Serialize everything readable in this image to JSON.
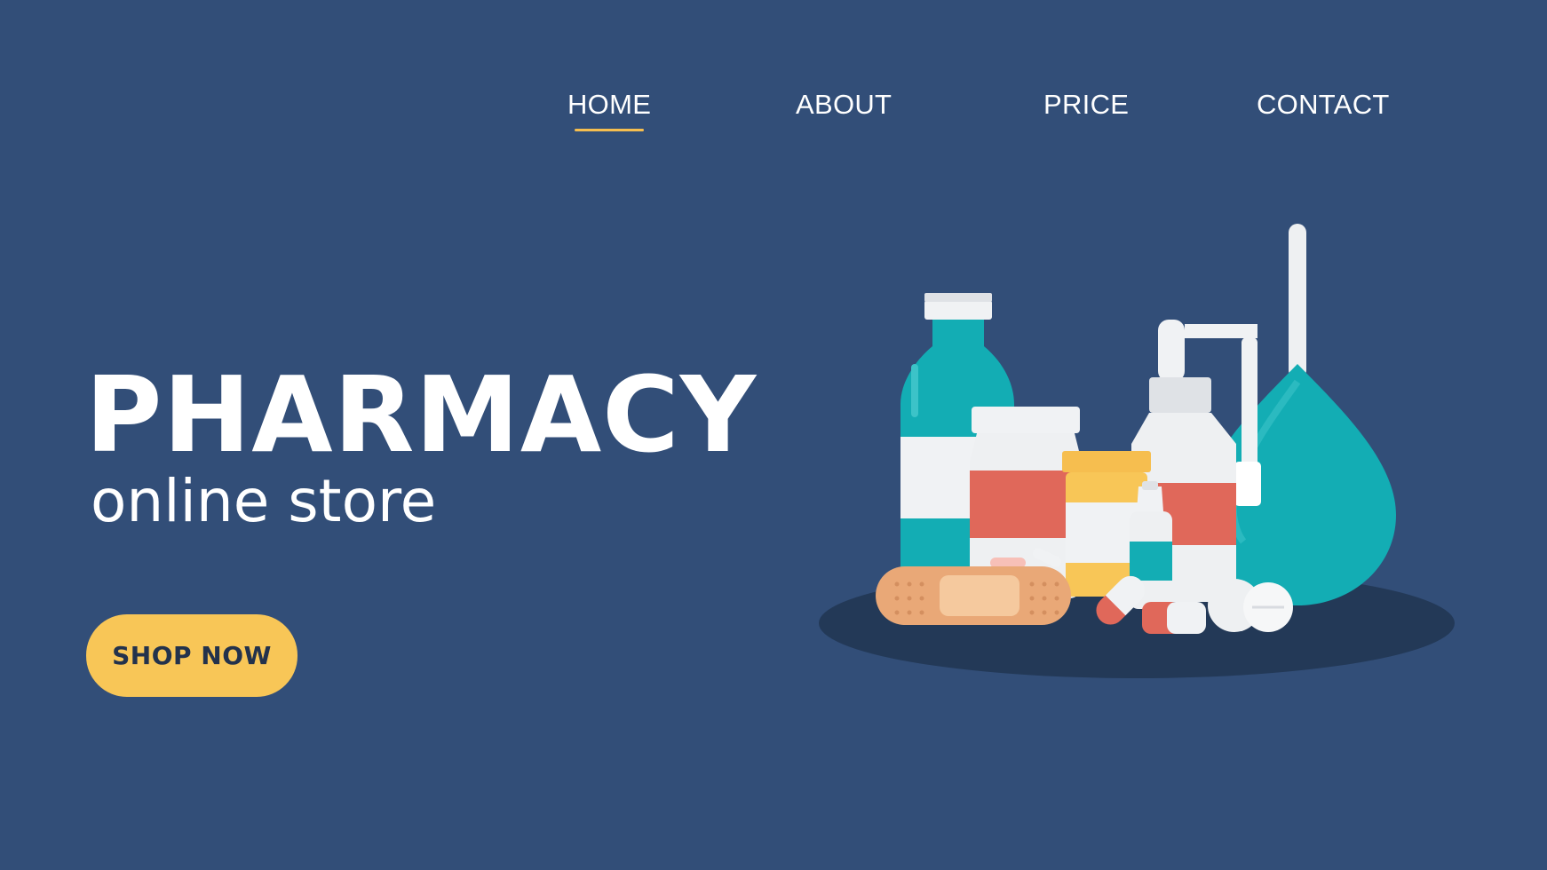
{
  "nav": {
    "items": [
      {
        "label": "HOME",
        "active": true
      },
      {
        "label": "ABOUT",
        "active": false
      },
      {
        "label": "PRICE",
        "active": false
      },
      {
        "label": "CONTACT",
        "active": false
      }
    ]
  },
  "hero": {
    "title": "PHARMACY",
    "subtitle": "online store",
    "cta_label": "SHOP NOW"
  },
  "colors": {
    "background": "#324e78",
    "accent": "#f6be4f",
    "button": "#f8c657",
    "teal": "#13adb4",
    "red": "#e0685a",
    "shadow": "#233957"
  },
  "illustration": {
    "icons": [
      "syrup-bottle-icon",
      "pill-jar-icon",
      "yellow-pill-bottle-icon",
      "nasal-spray-icon",
      "eye-drops-icon",
      "enema-bulb-icon",
      "bandage-icon",
      "capsule-icon",
      "tablet-icon"
    ]
  }
}
